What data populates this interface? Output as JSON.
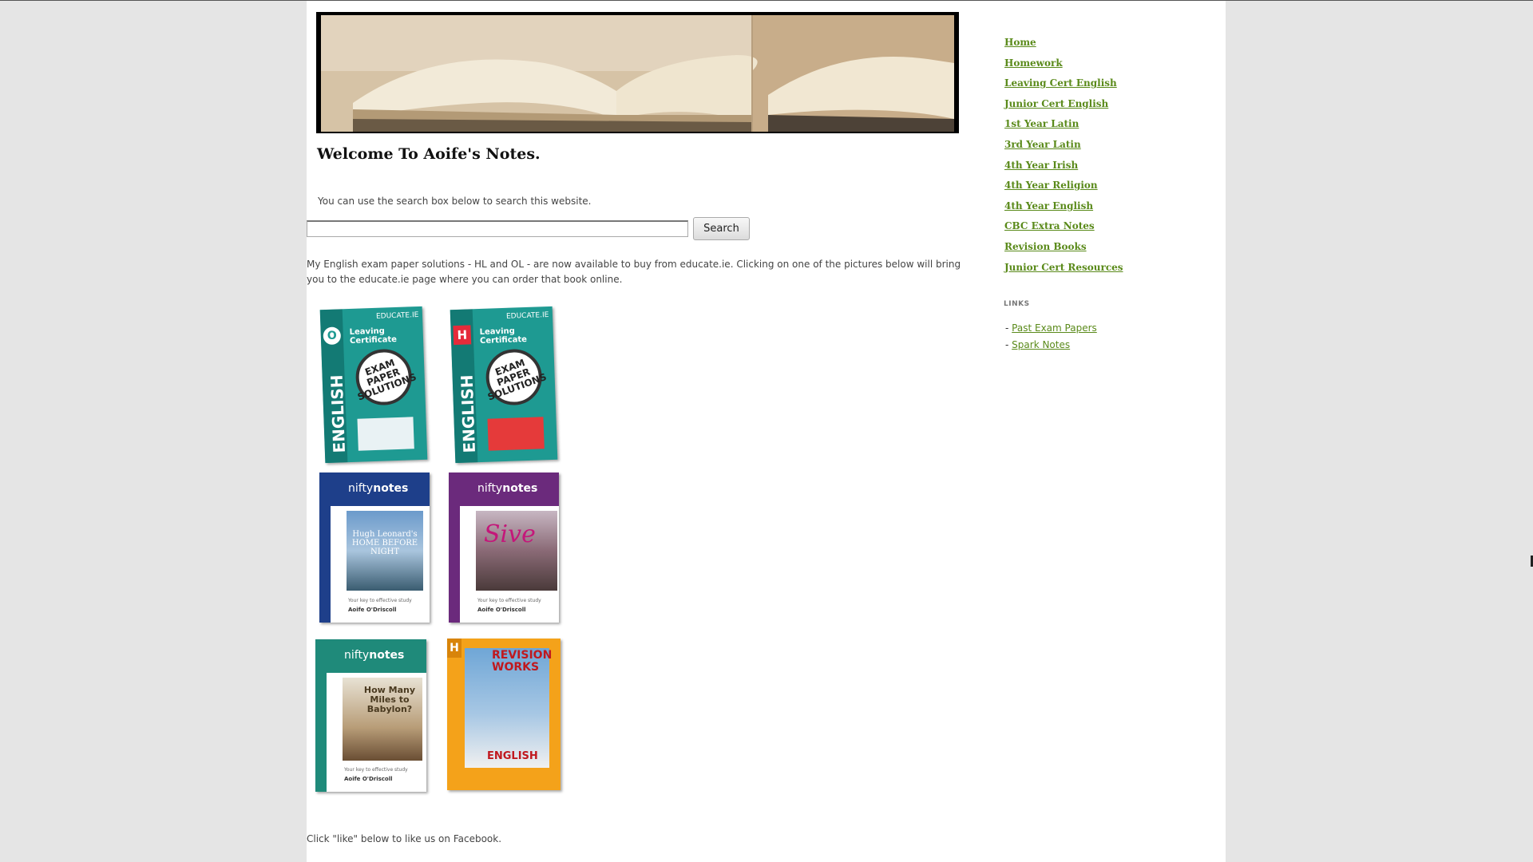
{
  "site": {
    "title": "Welcome To Aoife's Notes.",
    "search_hint": "You can use the search box below to search this website.",
    "search_placeholder": "",
    "search_button": "Search",
    "intro": "My English exam paper solutions - HL and OL - are now available to buy from educate.ie. Clicking on one of the pictures below will bring you to the educate.ie page where you can order that book online.",
    "facebook_text": "Click \"like\" below to like us on Facebook."
  },
  "books": [
    {
      "level": "O",
      "brand": "EDUCATE.IE",
      "title": "Leaving Certificate",
      "stamp": "EXAM PAPER SOLUTIONS",
      "spine": "ENGLISH",
      "color": "#1e9a92"
    },
    {
      "level": "H",
      "brand": "EDUCATE.IE",
      "title": "Leaving Certificate",
      "stamp": "EXAM PAPER SOLUTIONS",
      "spine": "ENGLISH",
      "color": "#1e9a92"
    },
    {
      "logo_a": "nifty",
      "logo_b": "notes",
      "title": "Hugh Leonard's HOME BEFORE NIGHT",
      "tagline": "Your key to effective study",
      "author": "Aoife O'Driscoll",
      "color": "#1e3f8a"
    },
    {
      "logo_a": "nifty",
      "logo_b": "notes",
      "title": "Sive",
      "tagline": "Your key to effective study",
      "author": "Aoife O'Driscoll",
      "color": "#6b2a7c"
    },
    {
      "logo_a": "nifty",
      "logo_b": "notes",
      "title": "How Many Miles to Babylon?",
      "tagline": "Your key to effective study",
      "author": "Aoife O'Driscoll",
      "color": "#1f8a7a"
    },
    {
      "level": "H",
      "title": "REVISION WORKS",
      "subtitle": "ENGLISH",
      "color": "#f4a21a"
    }
  ],
  "sidebar": {
    "nav": [
      "Home",
      "Homework",
      "Leaving Cert English",
      "Junior Cert English",
      "1st Year Latin",
      "3rd Year Latin",
      "4th Year Irish",
      "4th Year Religion",
      "4th Year English",
      "CBC Extra Notes",
      "Revision Books",
      "Junior Cert Resources"
    ],
    "links_heading": "LINKS",
    "links": [
      "Past Exam Papers",
      "Spark Notes"
    ],
    "link_bullet": "-"
  },
  "colors": {
    "link": "#5a8a1a",
    "background": "#e5e5e5",
    "page": "#ffffff"
  }
}
